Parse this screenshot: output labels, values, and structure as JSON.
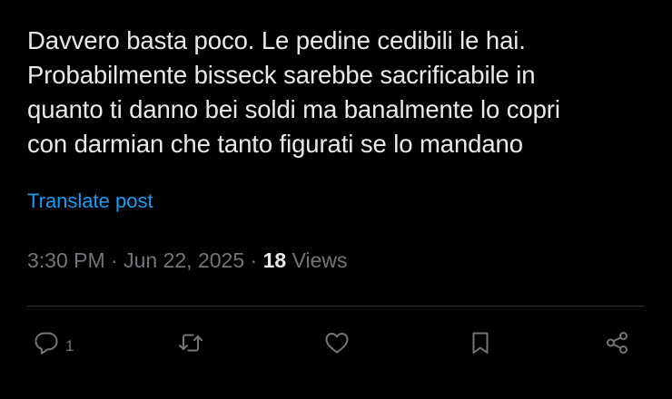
{
  "post": {
    "text_lines": [
      "Davvero basta poco. Le pedine cedibili le hai.",
      "Probabilmente bisseck sarebbe sacrificabile in",
      "quanto ti danno bei soldi ma banalmente lo copri",
      "con darmian che tanto figurati se lo mandano"
    ],
    "translate_label": "Translate post",
    "time": "3:30 PM",
    "separator": " · ",
    "date": "Jun 22, 2025",
    "views_count": "18",
    "views_label": "Views"
  },
  "actions": {
    "reply_icon": "reply-bubble-icon",
    "reply_count": "1",
    "repost_icon": "repost-arrows-icon",
    "like_icon": "heart-icon",
    "bookmark_icon": "bookmark-icon",
    "share_icon": "share-icon"
  },
  "colors": {
    "background": "#000000",
    "text": "#e7e9ea",
    "link": "#1d9bf0",
    "muted": "#71767b",
    "divider": "#2f3336"
  }
}
